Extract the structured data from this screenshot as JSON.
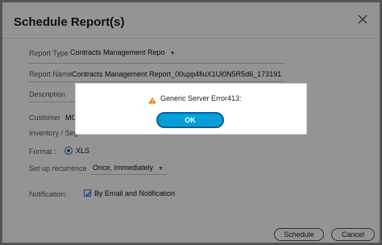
{
  "dialog": {
    "title": "Schedule Report(s)",
    "close_icon": "close-icon"
  },
  "form": {
    "report_type_label": "Report Type",
    "report_type_value": "Contracts Management Repo",
    "report_name_label": "Report Name",
    "report_name_value": "Contracts Management Report_00upp4fiuX1Ul0N5R5d6_173191",
    "description_label": "Description",
    "customer_label": "Customer",
    "customer_value": "MO",
    "inventory_label": "Inventory / Seg",
    "format_label": "Format :",
    "format_value": "XLS",
    "recurrence_label": "Set up recurrence",
    "recurrence_value": "Once, Immediately",
    "notification_label": "Notification:",
    "notification_value": "By Email and Notification"
  },
  "buttons": {
    "schedule": "Schedule",
    "cancel": "Cancel"
  },
  "alert": {
    "icon": "warning-icon",
    "message": "Generic Server Error413:",
    "ok": "OK"
  },
  "colors": {
    "accent": "#049fd9",
    "accent_border": "#0b5f9e",
    "warning": "#f0760c",
    "checkbox": "#1a6fc4"
  }
}
